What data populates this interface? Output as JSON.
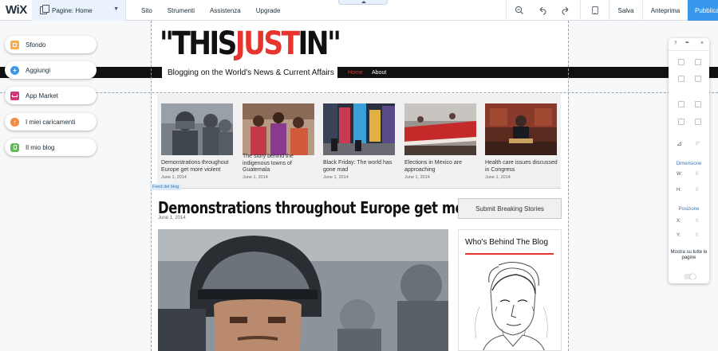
{
  "editor": {
    "logo": "WiX",
    "pages_dropdown": "Pagine: Home",
    "menu": [
      "Sito",
      "Strumenti",
      "Assistenza",
      "Upgrade"
    ],
    "save_label": "Salva",
    "preview_label": "Anteprima",
    "publish_label": "Pubblica",
    "icons": [
      "zoom-out-icon",
      "undo-icon",
      "redo-icon",
      "mobile-view-icon"
    ]
  },
  "left_panel": [
    {
      "label": "Sfondo",
      "icon": "background-icon",
      "color": "#fcaa4a"
    },
    {
      "label": "Aggiungi",
      "icon": "add-icon",
      "color": "#3899ec"
    },
    {
      "label": "App Market",
      "icon": "app-market-icon",
      "color": "#d1397a"
    },
    {
      "label": "I miei caricamenti",
      "icon": "upload-icon",
      "color": "#f58b3c"
    },
    {
      "label": "Il mio blog",
      "icon": "blog-icon",
      "color": "#60bc57"
    }
  ],
  "site": {
    "title_part1": "\"THIS",
    "title_part2": "JUST",
    "title_part3": "IN\"",
    "tagline": "Blogging on the World's News & Current Affairs",
    "nav": [
      "Home",
      "About"
    ],
    "feed_label": "Feed del blog",
    "thumbs": [
      {
        "title": "Demonstrations throughout Europe get more violent",
        "date": "June 1, 2014"
      },
      {
        "title": "The story behind the indigenous towns of Guatemala",
        "date": "June 1, 2014"
      },
      {
        "title": "Black Friday: The world has gone mad",
        "date": "June 1, 2014"
      },
      {
        "title": "Elections in Mexico are approaching",
        "date": "June 1, 2014"
      },
      {
        "title": "Health care issues discussed in Congress",
        "date": "June 1, 2014"
      }
    ],
    "post_title": "Demonstrations throughout Europe get more violent",
    "post_date": "June 1, 2014",
    "submit_button": "Submit Breaking Stories",
    "widget_title": "Who's Behind The Blog",
    "accent_color": "#e8342e"
  },
  "right_panel": {
    "help": "?",
    "close": "×",
    "dimension_label": "Dimensione",
    "w_label": "W:",
    "h_label": "H:",
    "w_value": "0",
    "h_value": "0",
    "rotation_value": "0°",
    "position_label": "Posizione",
    "x_label": "X:",
    "y_label": "Y:",
    "x_value": "0",
    "y_value": "0",
    "show_all_label": "Mostra su tutte le pagine"
  }
}
